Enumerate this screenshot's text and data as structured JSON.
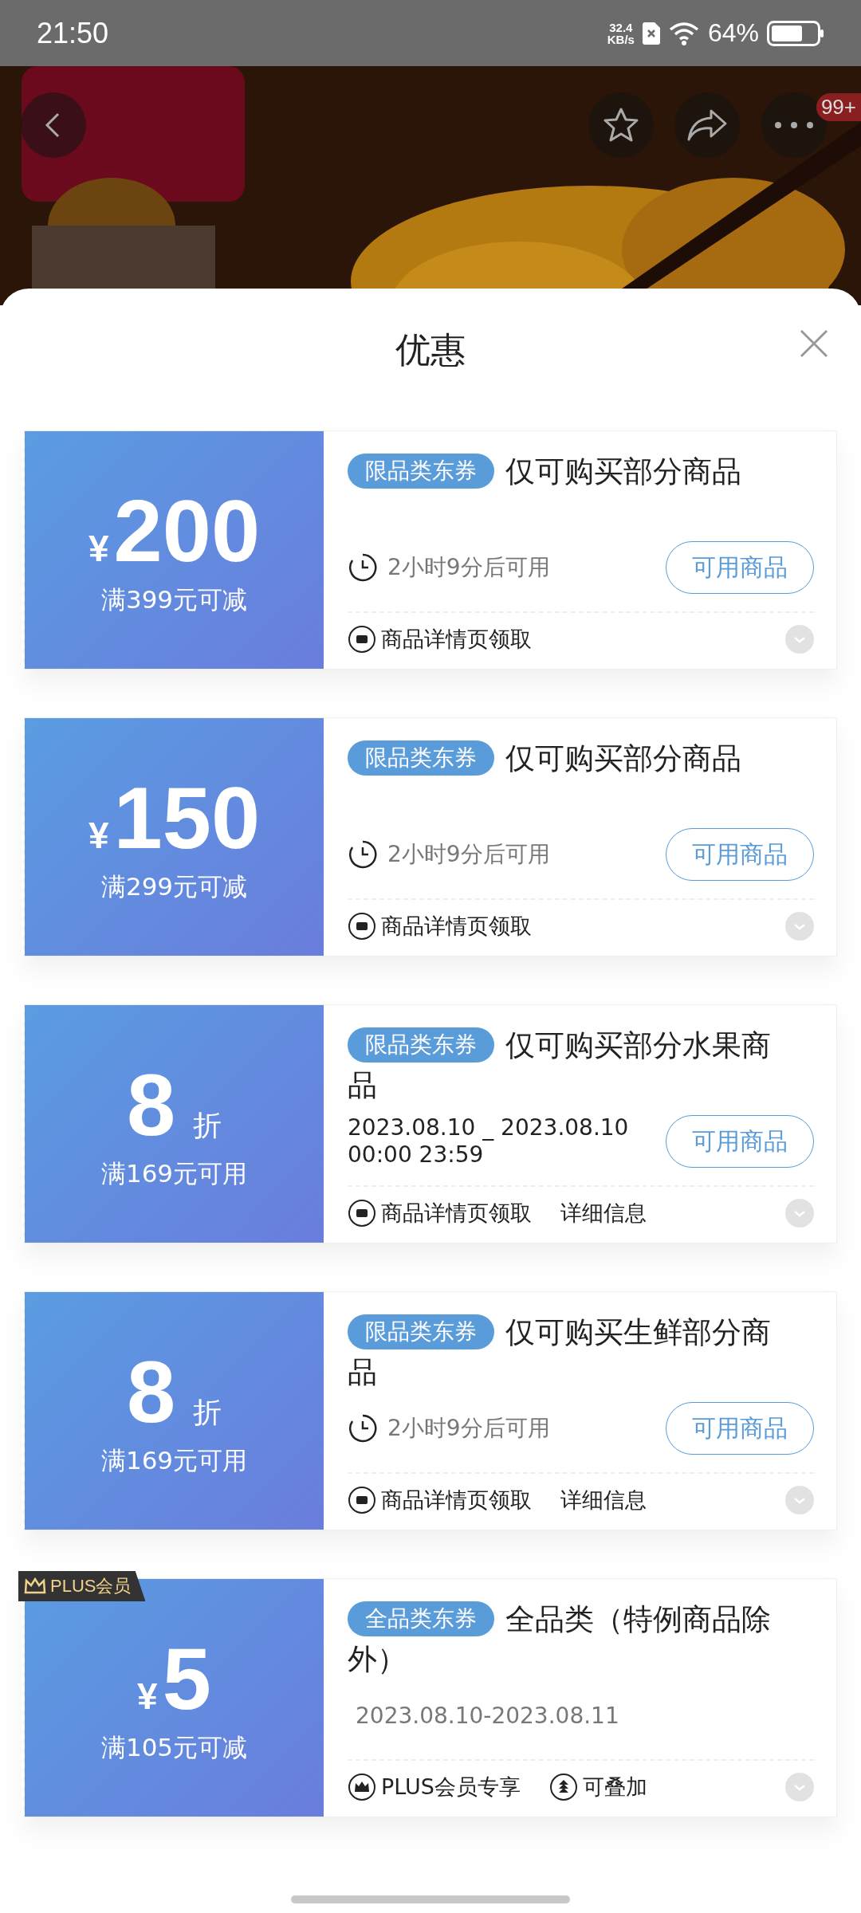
{
  "status_bar": {
    "time": "21:50",
    "net_speed": [
      "32.4",
      "KB/s"
    ],
    "battery": "64%"
  },
  "header": {
    "badge": "99+"
  },
  "sheet": {
    "title": "优惠",
    "coupons": [
      {
        "kind": "cash",
        "currency": "¥",
        "amount": "200",
        "condition": "满399元可减",
        "tag": "限品类东券",
        "title": "仅可购买部分商品",
        "validity": {
          "kind": "timer",
          "lines": [
            "2小时9分后可用"
          ]
        },
        "button": "可用商品",
        "footer": [
          {
            "kind": "source",
            "text": "商品详情页领取"
          }
        ]
      },
      {
        "kind": "cash",
        "currency": "¥",
        "amount": "150",
        "condition": "满299元可减",
        "tag": "限品类东券",
        "title": "仅可购买部分商品",
        "validity": {
          "kind": "timer",
          "lines": [
            "2小时9分后可用"
          ]
        },
        "button": "可用商品",
        "footer": [
          {
            "kind": "source",
            "text": "商品详情页领取"
          }
        ]
      },
      {
        "kind": "discount",
        "amount": "8",
        "unit": "折",
        "condition": "满169元可用",
        "tag": "限品类东券",
        "title": "仅可购买部分水果商品",
        "validity": {
          "kind": "dates",
          "lines": [
            "2023.08.10 _ 2023.08.10",
            "00:00 23:59"
          ]
        },
        "button": "可用商品",
        "footer": [
          {
            "kind": "source",
            "text": "商品详情页领取"
          },
          {
            "kind": "info",
            "text": "详细信息"
          }
        ]
      },
      {
        "kind": "discount",
        "amount": "8",
        "unit": "折",
        "condition": "满169元可用",
        "tag": "限品类东券",
        "title": "仅可购买生鲜部分商品",
        "validity": {
          "kind": "timer",
          "lines": [
            "2小时9分后可用"
          ]
        },
        "button": "可用商品",
        "footer": [
          {
            "kind": "source",
            "text": "商品详情页领取"
          },
          {
            "kind": "info",
            "text": "详细信息"
          }
        ]
      },
      {
        "plus_badge": "PLUS会员",
        "kind": "cash",
        "currency": "¥",
        "amount": "5",
        "condition": "满105元可减",
        "tag": "全品类东券",
        "title": "全品类（特例商品除外）",
        "validity": {
          "kind": "range",
          "lines": [
            "2023.08.10-2023.08.11"
          ]
        },
        "footer": [
          {
            "kind": "plus",
            "text": "PLUS会员专享"
          },
          {
            "kind": "stack",
            "text": "可叠加"
          }
        ]
      }
    ]
  }
}
